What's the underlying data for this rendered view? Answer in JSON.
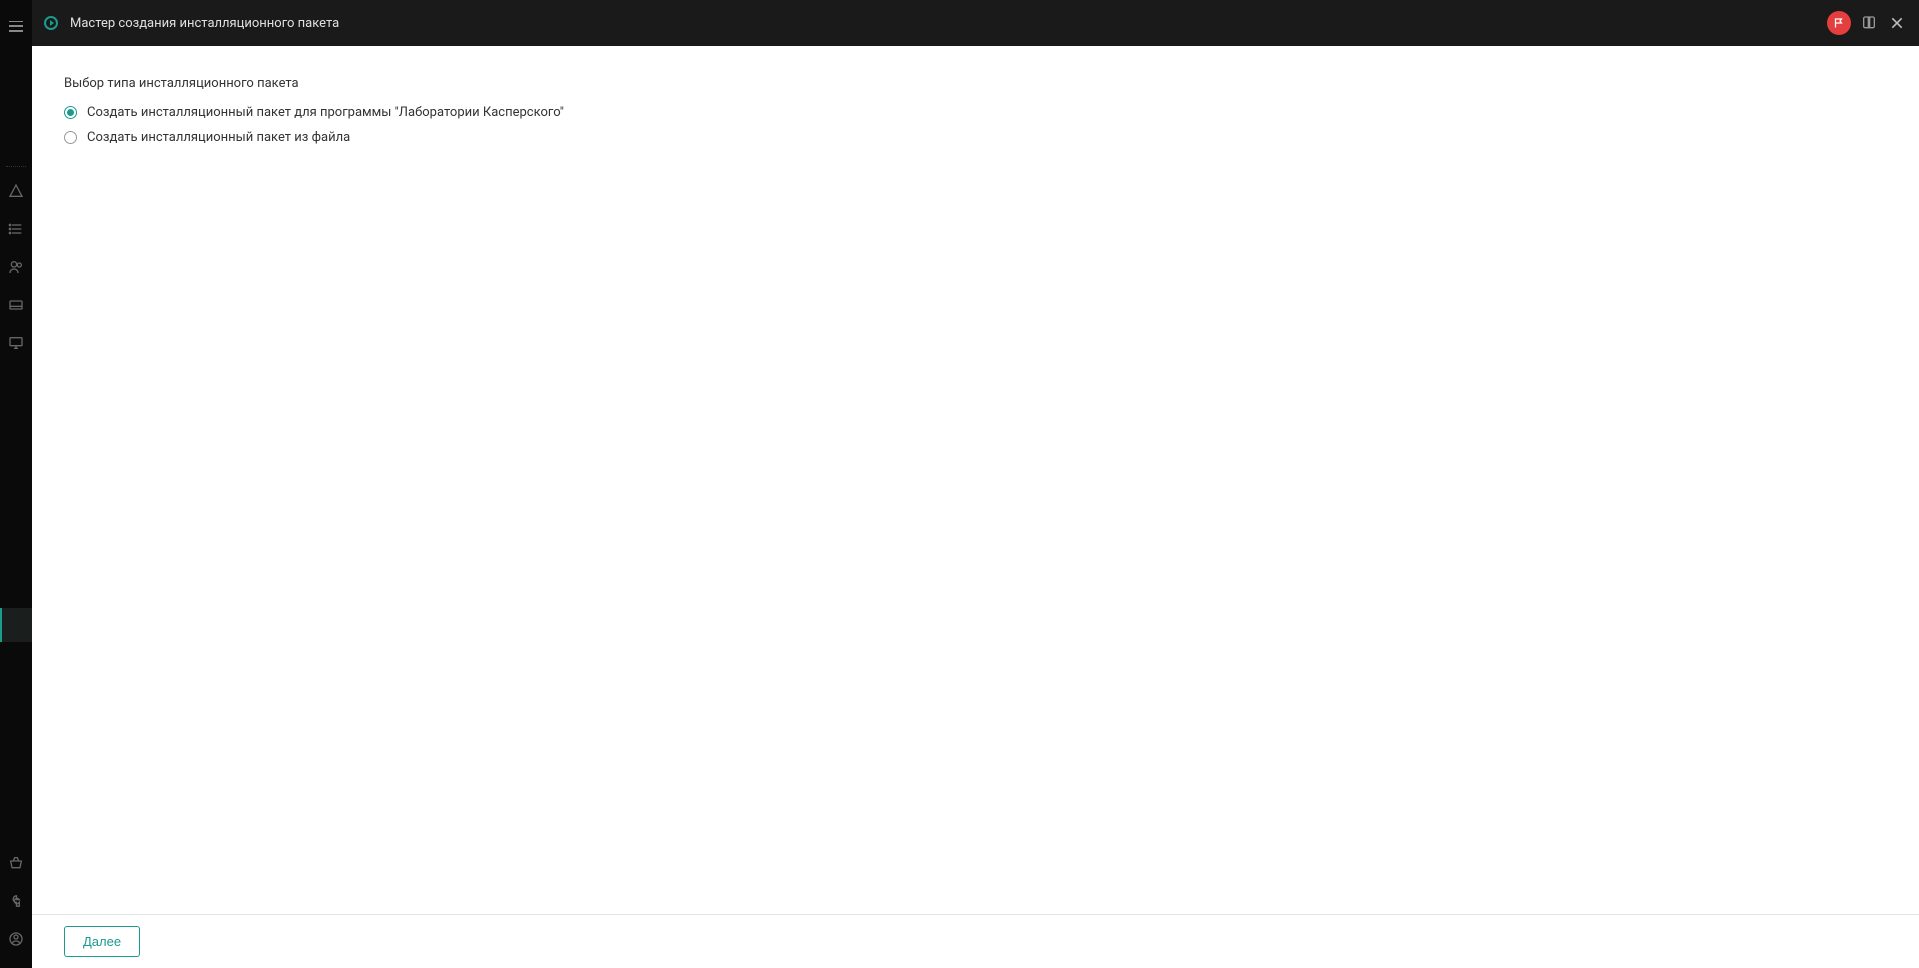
{
  "header": {
    "title": "Мастер создания инсталляционного пакета"
  },
  "content": {
    "section_title": "Выбор типа инсталляционного пакета",
    "radio_options": [
      {
        "label": "Создать инсталляционный пакет для программы \"Лаборатории Касперского\"",
        "checked": true
      },
      {
        "label": "Создать инсталляционный пакет из файла",
        "checked": false
      }
    ]
  },
  "footer": {
    "next_label": "Далее"
  },
  "sidebar": {
    "items": [
      {
        "name": "alert-icon"
      },
      {
        "name": "list-icon"
      },
      {
        "name": "users-icon"
      },
      {
        "name": "devices-icon"
      },
      {
        "name": "monitor-icon"
      }
    ],
    "bottom_items": [
      {
        "name": "basket-icon"
      },
      {
        "name": "wrench-icon"
      },
      {
        "name": "account-icon"
      }
    ]
  }
}
